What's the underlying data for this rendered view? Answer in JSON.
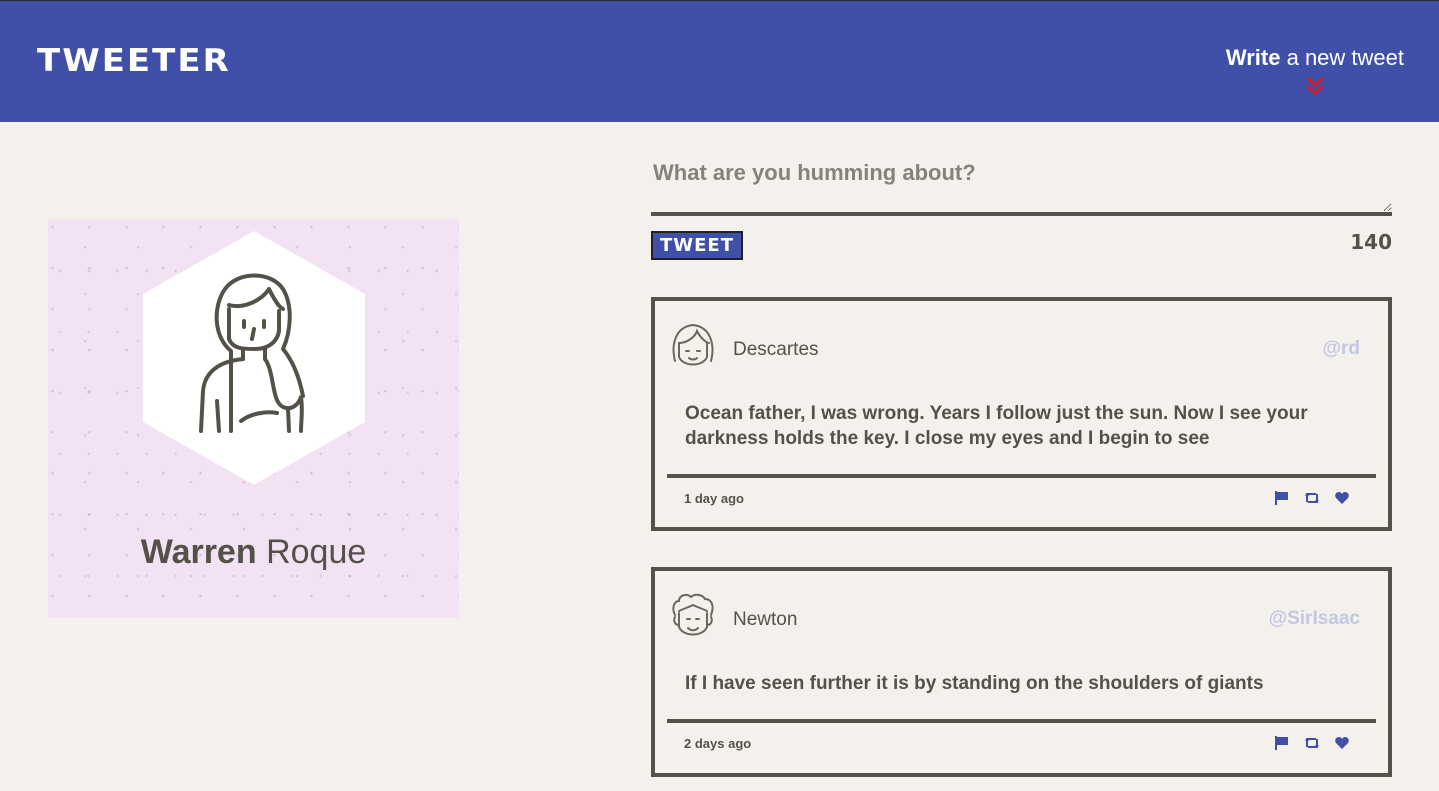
{
  "nav": {
    "brand": "TWEETER",
    "compose_strong": "Write",
    "compose_light": " a new tweet",
    "compose_icon": "double-chevron-down",
    "accent_color": "#cc1d2b",
    "bar_color": "#4050a8"
  },
  "profile": {
    "first_name": "Warren",
    "last_name": " Roque",
    "avatar_icon": "woman-avatar",
    "card_color": "#f2e2f3"
  },
  "composer": {
    "placeholder": "What are you humming about?",
    "button_label": "TWEET",
    "counter": "140"
  },
  "tweets": [
    {
      "author": "Descartes",
      "handle": "@rd",
      "avatar_icon": "girl-avatar",
      "content": "Ocean father, I was wrong. Years I follow just the sun. Now I see your darkness holds the key. I close my eyes and I begin to see",
      "timestamp": "1 day ago",
      "actions": [
        "flag-icon",
        "retweet-icon",
        "heart-icon"
      ]
    },
    {
      "author": "Newton",
      "handle": "@SirIsaac",
      "avatar_icon": "curly-hair-avatar",
      "content": "If I have seen further it is by standing on the shoulders of giants",
      "timestamp": "2 days ago",
      "actions": [
        "flag-icon",
        "retweet-icon",
        "heart-icon"
      ]
    }
  ]
}
